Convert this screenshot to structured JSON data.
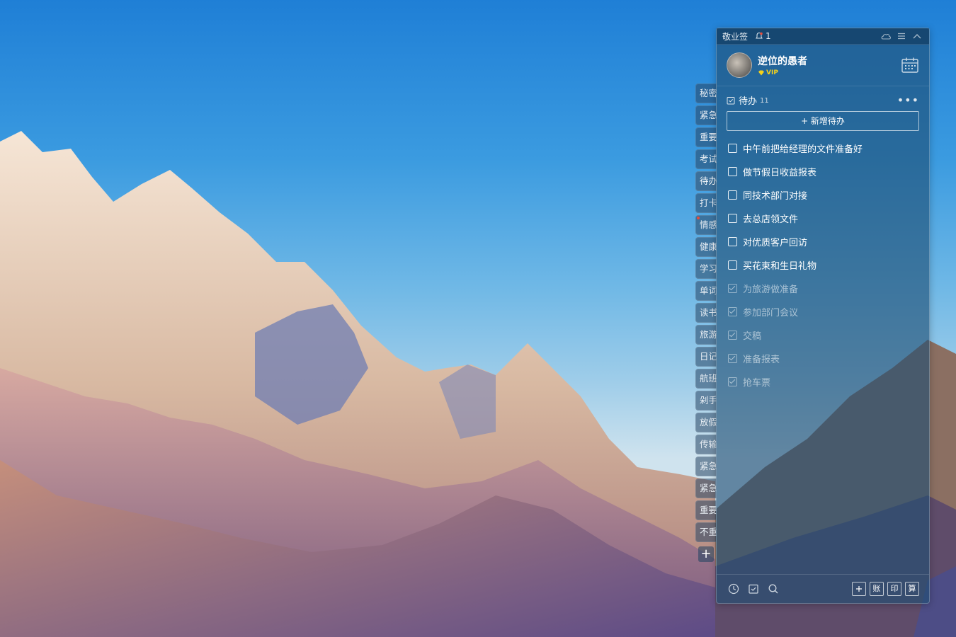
{
  "app": {
    "title": "敬业签",
    "notification_count": "1"
  },
  "user": {
    "name": "逆位的愚者",
    "badge": "VIP"
  },
  "section": {
    "title": "待办",
    "count": "11",
    "add_label": "+ 新增待办"
  },
  "todos": [
    {
      "text": "中午前把给经理的文件准备好",
      "done": false
    },
    {
      "text": "做节假日收益报表",
      "done": false
    },
    {
      "text": "同技术部门对接",
      "done": false
    },
    {
      "text": "去总店领文件",
      "done": false
    },
    {
      "text": "对优质客户回访",
      "done": false
    },
    {
      "text": "买花束和生日礼物",
      "done": false
    },
    {
      "text": "为旅游做准备",
      "done": true
    },
    {
      "text": "参加部门会议",
      "done": true
    },
    {
      "text": "交稿",
      "done": true
    },
    {
      "text": "准备报表",
      "done": true
    },
    {
      "text": "抢车票",
      "done": true
    }
  ],
  "side_tabs": [
    {
      "label": "秘密",
      "active": false
    },
    {
      "label": "紧急",
      "active": false
    },
    {
      "label": "重要",
      "active": false
    },
    {
      "label": "考试",
      "active": false
    },
    {
      "label": "待办",
      "active": true
    },
    {
      "label": "打卡",
      "active": false
    },
    {
      "label": "情感",
      "active": false,
      "flag": true
    },
    {
      "label": "健康",
      "active": false
    },
    {
      "label": "学习",
      "active": false
    },
    {
      "label": "单词",
      "active": false
    },
    {
      "label": "读书",
      "active": false
    },
    {
      "label": "旅游",
      "active": false
    },
    {
      "label": "日记",
      "active": false
    },
    {
      "label": "航班",
      "active": false
    },
    {
      "label": "剁手",
      "active": false
    },
    {
      "label": "放假",
      "active": false
    },
    {
      "label": "传输",
      "active": false
    },
    {
      "label": "紧急",
      "active": false
    },
    {
      "label": "紧急",
      "active": false
    },
    {
      "label": "重要",
      "active": false
    },
    {
      "label": "不重",
      "active": false
    }
  ],
  "side_add_label": "+",
  "footer": {
    "buttons": [
      "账",
      "印",
      "算"
    ]
  },
  "icons": {
    "title_bell": "bell-icon",
    "cloud": "cloud-icon",
    "menu": "menu-icon",
    "collapse": "chevron-up-icon",
    "calendar": "calendar-icon",
    "section": "checklist-icon",
    "more": "more-icon",
    "footer_left": [
      "clock-icon",
      "checklist-icon",
      "search-icon"
    ],
    "footer_add": "add-note-icon"
  },
  "colors": {
    "vip": "#f5d21a",
    "notification_dot": "#e74c3c"
  }
}
